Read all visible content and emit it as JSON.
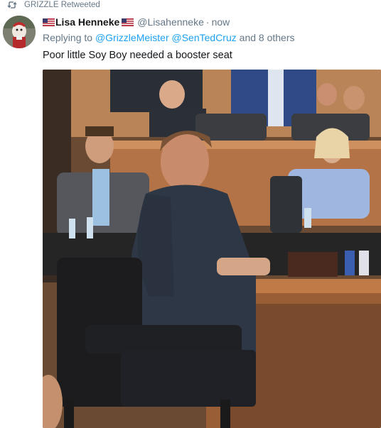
{
  "retweet": {
    "text": "GRIZZLE Retweeted",
    "icon": "retweet-icon"
  },
  "tweet": {
    "display_name": "Lisa Henneke",
    "handle": "@Lisahenneke",
    "separator": "·",
    "timestamp": "now",
    "reply": {
      "prefix": "Replying to",
      "mentions": [
        "@GrizzleMeister",
        "@SenTedCruz"
      ],
      "suffix": "and 8 others"
    },
    "text": "Poor little Soy Boy needed a booster seat",
    "flag_icon": "us-flag-icon"
  },
  "colors": {
    "link": "#1da1f2",
    "secondary_text": "#657786",
    "primary_text": "#14171a"
  }
}
